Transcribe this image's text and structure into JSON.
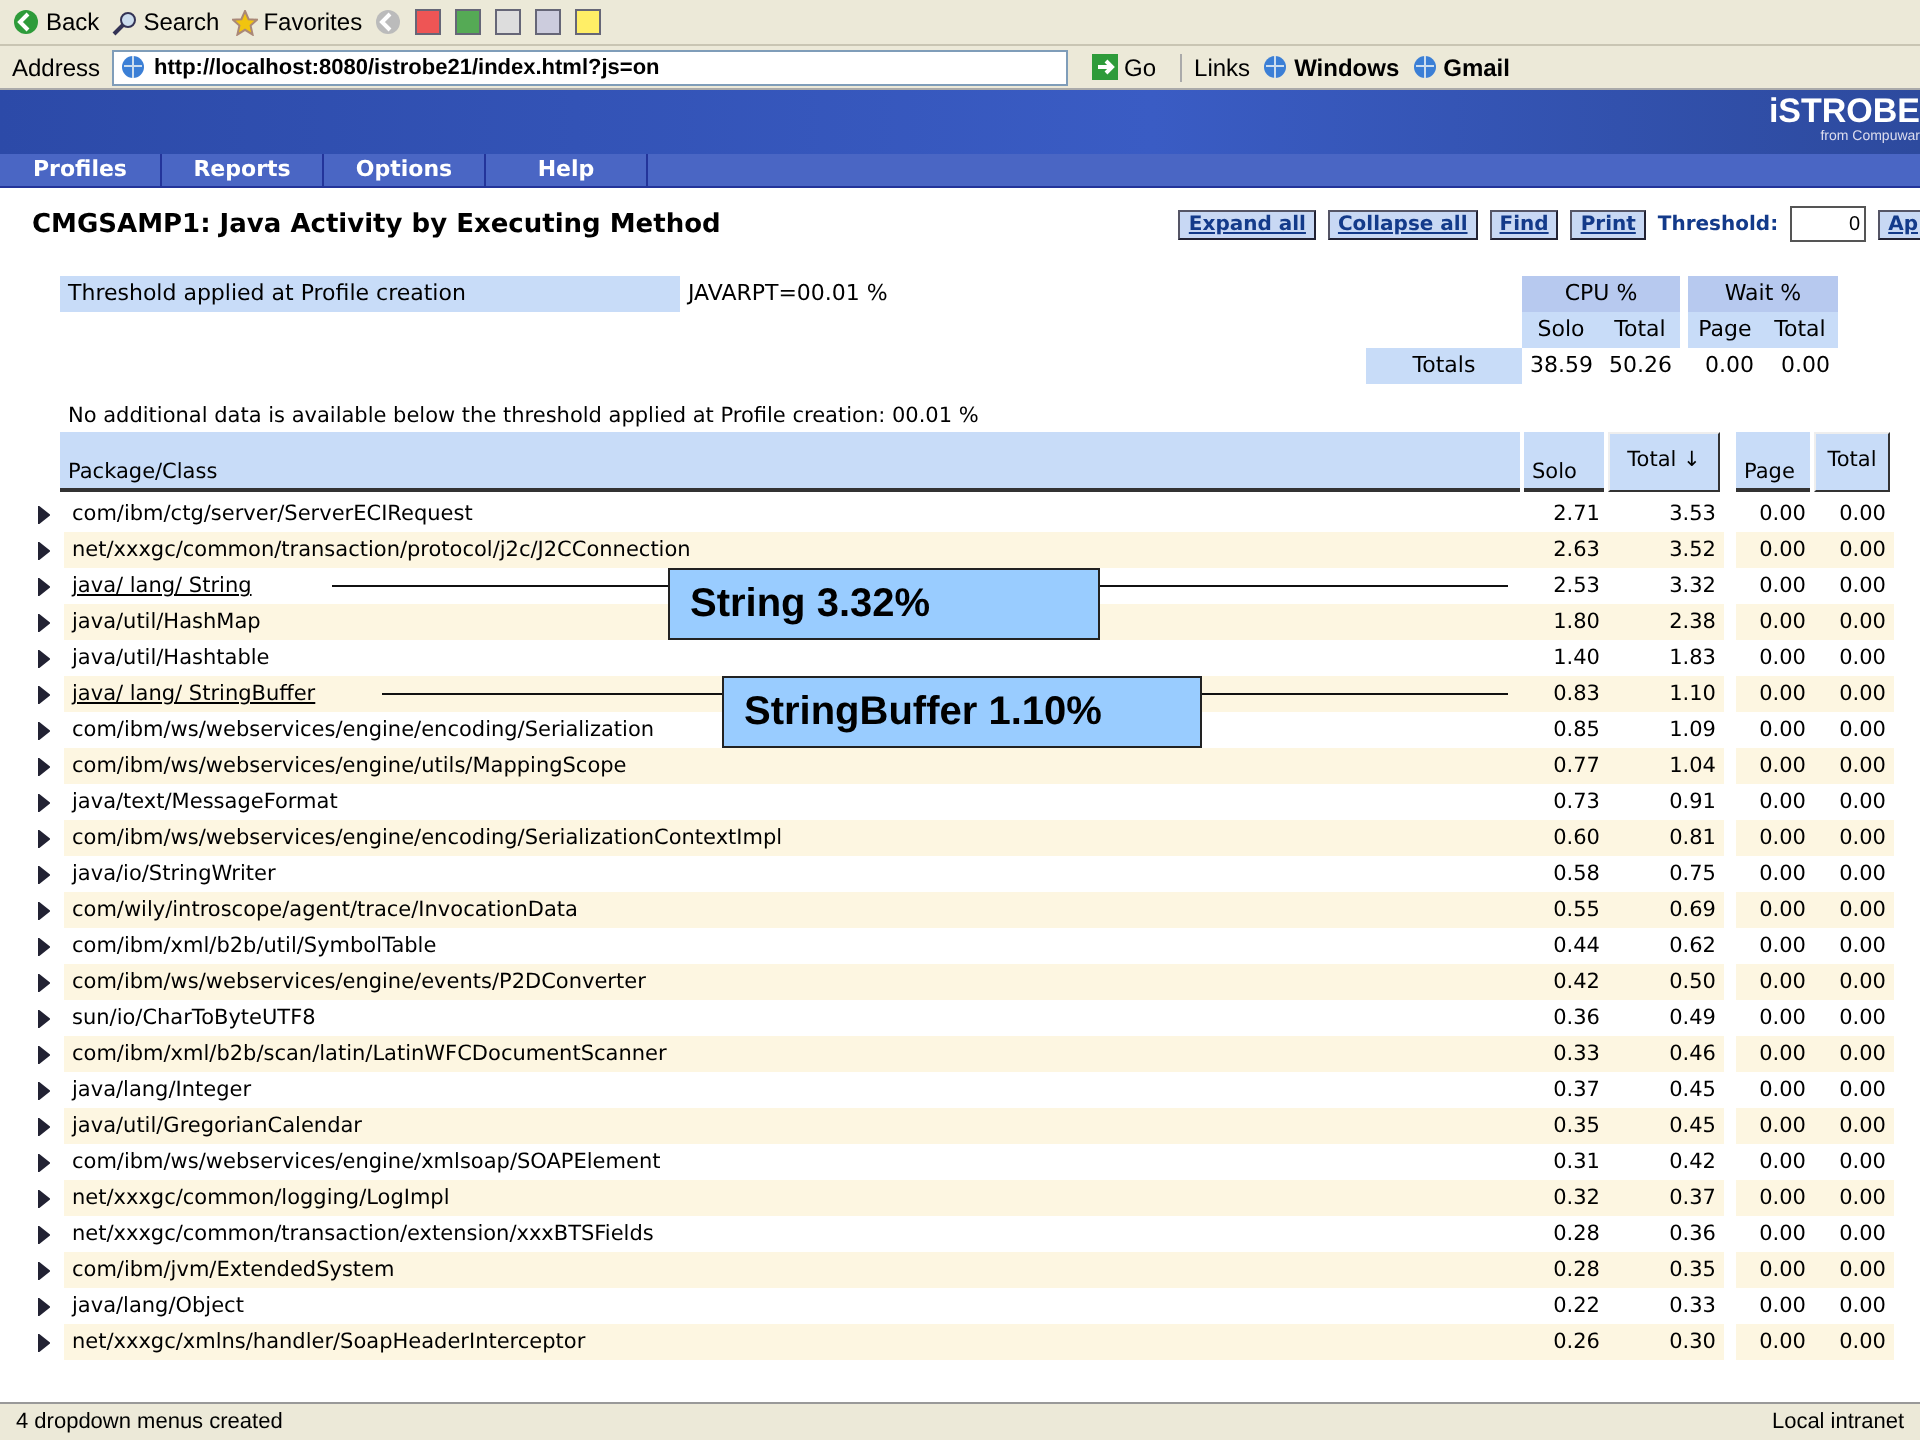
{
  "browser_toolbar": {
    "buttons": [
      {
        "label": "Back"
      },
      {
        "label": "Search"
      },
      {
        "label": "Favorites"
      }
    ]
  },
  "address_bar": {
    "label": "Address",
    "value": "http://localhost:8080/istrobe21/index.html?js=on",
    "go": "Go",
    "links_label": "Links",
    "links": [
      "Windows",
      "Gmail"
    ]
  },
  "banner": {
    "brand": "iSTROBE",
    "sub": "from Compuwar"
  },
  "menu": [
    {
      "label": "Profiles"
    },
    {
      "label": "Reports"
    },
    {
      "label": "Options"
    },
    {
      "label": "Help"
    }
  ],
  "title": "CMGSAMP1: Java Activity by Executing Method",
  "actions": [
    "Expand all",
    "Collapse all",
    "Find",
    "Print"
  ],
  "threshold": {
    "label": "Threshold:",
    "value": "0",
    "apply": "Ap"
  },
  "summary": {
    "threshold_label": "Threshold applied at Profile creation",
    "threshold_value": "JAVARPT=00.01 %",
    "groups": [
      "CPU %",
      "Wait %"
    ],
    "subheaders": [
      "Solo",
      "Total",
      "Page",
      "Total"
    ],
    "totals_label": "Totals",
    "totals": [
      "38.59",
      "50.26",
      "0.00",
      "0.00"
    ]
  },
  "note": "No additional data is available below the threshold applied at Profile creation:  00.01 %",
  "table": {
    "columns": [
      "Package/Class",
      "Solo",
      "Total ↓",
      "Page",
      "Total"
    ],
    "rows": [
      {
        "name": "com/ibm/ctg/server/ServerECIRequest",
        "values": [
          "2.71",
          "3.53",
          "0.00",
          "0.00"
        ],
        "underlined": false
      },
      {
        "name": "net/xxxgc/common/transaction/protocol/j2c/J2CConnection",
        "values": [
          "2.63",
          "3.52",
          "0.00",
          "0.00"
        ],
        "underlined": false
      },
      {
        "name": "java/ lang/ String",
        "values": [
          "2.53",
          "3.32",
          "0.00",
          "0.00"
        ],
        "underlined": true,
        "callout": "String 3.32%"
      },
      {
        "name": "java/util/HashMap",
        "values": [
          "1.80",
          "2.38",
          "0.00",
          "0.00"
        ],
        "underlined": false
      },
      {
        "name": "java/util/Hashtable",
        "values": [
          "1.40",
          "1.83",
          "0.00",
          "0.00"
        ],
        "underlined": false
      },
      {
        "name": "java/ lang/ StringBuffer",
        "values": [
          "0.83",
          "1.10",
          "0.00",
          "0.00"
        ],
        "underlined": true,
        "callout": "StringBuffer 1.10%"
      },
      {
        "name": "com/ibm/ws/webservices/engine/encoding/Serialization",
        "values": [
          "0.85",
          "1.09",
          "0.00",
          "0.00"
        ],
        "underlined": false
      },
      {
        "name": "com/ibm/ws/webservices/engine/utils/MappingScope",
        "values": [
          "0.77",
          "1.04",
          "0.00",
          "0.00"
        ],
        "underlined": false
      },
      {
        "name": "java/text/MessageFormat",
        "values": [
          "0.73",
          "0.91",
          "0.00",
          "0.00"
        ],
        "underlined": false
      },
      {
        "name": "com/ibm/ws/webservices/engine/encoding/SerializationContextImpl",
        "values": [
          "0.60",
          "0.81",
          "0.00",
          "0.00"
        ],
        "underlined": false
      },
      {
        "name": "java/io/StringWriter",
        "values": [
          "0.58",
          "0.75",
          "0.00",
          "0.00"
        ],
        "underlined": false
      },
      {
        "name": "com/wily/introscope/agent/trace/InvocationData",
        "values": [
          "0.55",
          "0.69",
          "0.00",
          "0.00"
        ],
        "underlined": false
      },
      {
        "name": "com/ibm/xml/b2b/util/SymbolTable",
        "values": [
          "0.44",
          "0.62",
          "0.00",
          "0.00"
        ],
        "underlined": false
      },
      {
        "name": "com/ibm/ws/webservices/engine/events/P2DConverter",
        "values": [
          "0.42",
          "0.50",
          "0.00",
          "0.00"
        ],
        "underlined": false
      },
      {
        "name": "sun/io/CharToByteUTF8",
        "values": [
          "0.36",
          "0.49",
          "0.00",
          "0.00"
        ],
        "underlined": false
      },
      {
        "name": "com/ibm/xml/b2b/scan/latin/LatinWFCDocumentScanner",
        "values": [
          "0.33",
          "0.46",
          "0.00",
          "0.00"
        ],
        "underlined": false
      },
      {
        "name": "java/lang/Integer",
        "values": [
          "0.37",
          "0.45",
          "0.00",
          "0.00"
        ],
        "underlined": false
      },
      {
        "name": "java/util/GregorianCalendar",
        "values": [
          "0.35",
          "0.45",
          "0.00",
          "0.00"
        ],
        "underlined": false
      },
      {
        "name": "com/ibm/ws/webservices/engine/xmlsoap/SOAPElement",
        "values": [
          "0.31",
          "0.42",
          "0.00",
          "0.00"
        ],
        "underlined": false
      },
      {
        "name": "net/xxxgc/common/logging/LogImpl",
        "values": [
          "0.32",
          "0.37",
          "0.00",
          "0.00"
        ],
        "underlined": false
      },
      {
        "name": "net/xxxgc/common/transaction/extension/xxxBTSFields",
        "values": [
          "0.28",
          "0.36",
          "0.00",
          "0.00"
        ],
        "underlined": false
      },
      {
        "name": "com/ibm/jvm/ExtendedSystem",
        "values": [
          "0.28",
          "0.35",
          "0.00",
          "0.00"
        ],
        "underlined": false
      },
      {
        "name": "java/lang/Object",
        "values": [
          "0.22",
          "0.33",
          "0.00",
          "0.00"
        ],
        "underlined": false
      },
      {
        "name": "net/xxxgc/xmlns/handler/SoapHeaderInterceptor",
        "values": [
          "0.26",
          "0.30",
          "0.00",
          "0.00"
        ],
        "underlined": false
      }
    ]
  },
  "status_bar": {
    "message": "4 dropdown menus created",
    "zone": "Local intranet"
  }
}
